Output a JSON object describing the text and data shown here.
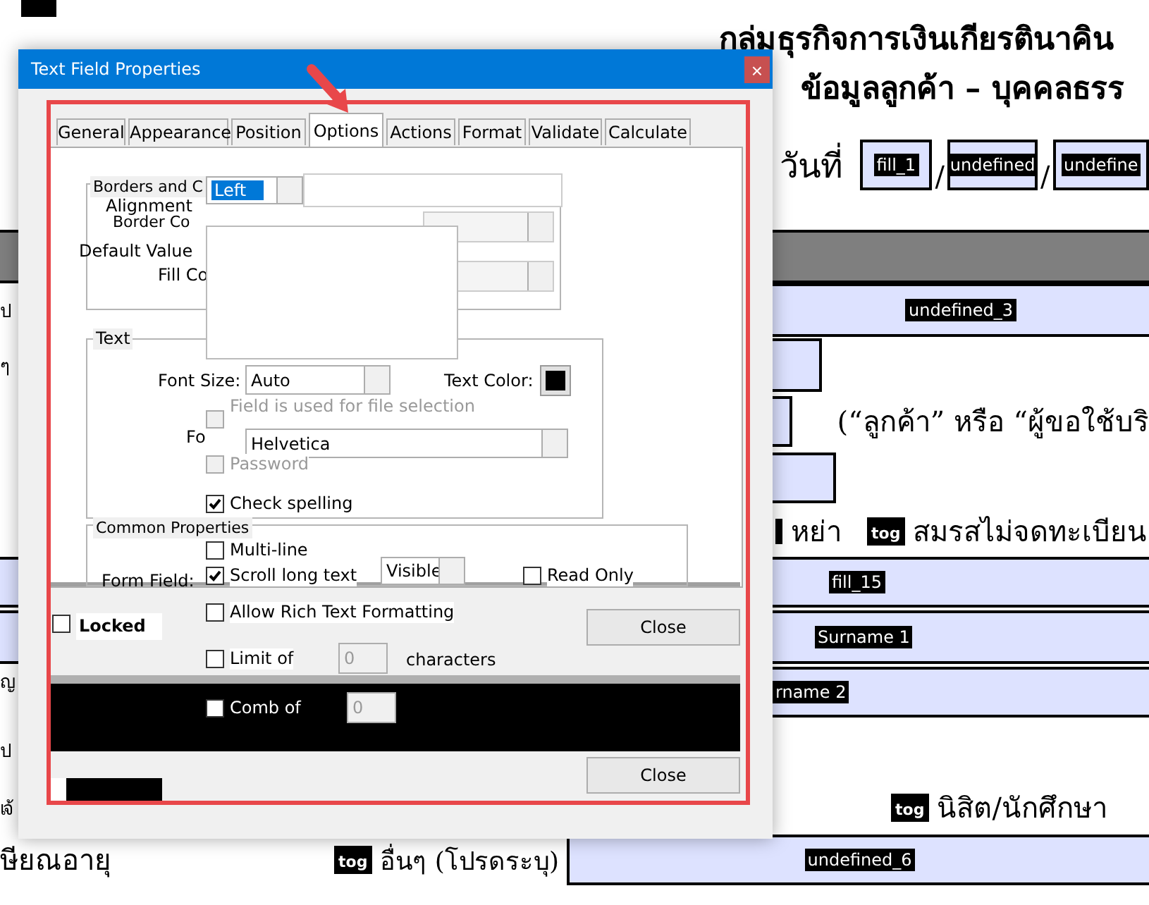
{
  "document": {
    "heading": "กลุ่มธุรกิจการเงินเกียรตินาคิน",
    "subheading": "ข้อมูลลูกค้า – บุคคลธรร",
    "date_label": "วันที่",
    "date_fields": [
      "fill_1",
      "undefined",
      "undefine"
    ],
    "date_separators": [
      "/",
      "/"
    ],
    "row_field": "undefined_3",
    "customer_note": "(“ลูกค้า” หรือ “ผู้ขอใช้บริ",
    "left_fragments": [
      "ป",
      "ๆ",
      "ญ",
      "ป",
      "เจ้"
    ],
    "marital_options": [
      {
        "label": "หย่า"
      },
      {
        "toggle": "tog",
        "label": "สมรสไม่จดทะเบียน"
      }
    ],
    "name_fields": [
      "fill_15",
      "Surname 1",
      "rname 2"
    ],
    "occupation_options": [
      {
        "toggle": "tog",
        "label": "นิสิต/นักศึกษา"
      },
      {
        "toggle": "tog",
        "label": "อื่นๆ (โปรดระบุ)"
      }
    ],
    "retired_label": "ษียณอายุ",
    "last_field": "undefined_6"
  },
  "dialog": {
    "title": "Text Field Properties",
    "close": "×",
    "tabs": [
      {
        "label": "General",
        "selected": false
      },
      {
        "label": "Appearance",
        "selected": false
      },
      {
        "label": "Position",
        "selected": false
      },
      {
        "label": "Options",
        "selected": true
      },
      {
        "label": "Actions",
        "selected": false
      },
      {
        "label": "Format",
        "selected": false
      },
      {
        "label": "Validate",
        "selected": false
      },
      {
        "label": "Calculate",
        "selected": false
      }
    ],
    "borders_legend": "Borders and C",
    "alignment_label": "Alignment",
    "alignment_value": "Left",
    "default_value_label": "Default Value",
    "border_color_label": "Border Co",
    "fill_color_label": "Fill Co",
    "text_legend": "Text",
    "font_size_label": "Font Size:",
    "font_size_value": "Auto",
    "text_color_label": "Text Color:",
    "font_label": "Fo",
    "font_value": "Helvetica",
    "common_legend": "Common Properties",
    "form_field_label": "Form Field:",
    "form_field_value": "Visible",
    "checkboxes": [
      {
        "label": "Field is used for file selection",
        "checked": false,
        "disabled": true
      },
      {
        "label": "Password",
        "checked": false,
        "disabled": true
      },
      {
        "label": "Check spelling",
        "checked": true,
        "disabled": false
      },
      {
        "label": "Multi-line",
        "checked": false,
        "disabled": false
      },
      {
        "label": "Scroll long text",
        "checked": true,
        "disabled": false
      },
      {
        "label": "Read Only",
        "checked": false,
        "disabled": false
      },
      {
        "label": "Locked",
        "checked": false,
        "disabled": false
      },
      {
        "label": "Allow Rich Text Formatting",
        "checked": false,
        "disabled": false
      },
      {
        "label": "Limit of",
        "checked": false,
        "disabled": false
      },
      {
        "label": "Comb of",
        "checked": false,
        "disabled": false
      }
    ],
    "limit_value": "0",
    "characters_label": "characters",
    "comb_value": "0",
    "buttons": [
      "Close",
      "Close"
    ]
  }
}
